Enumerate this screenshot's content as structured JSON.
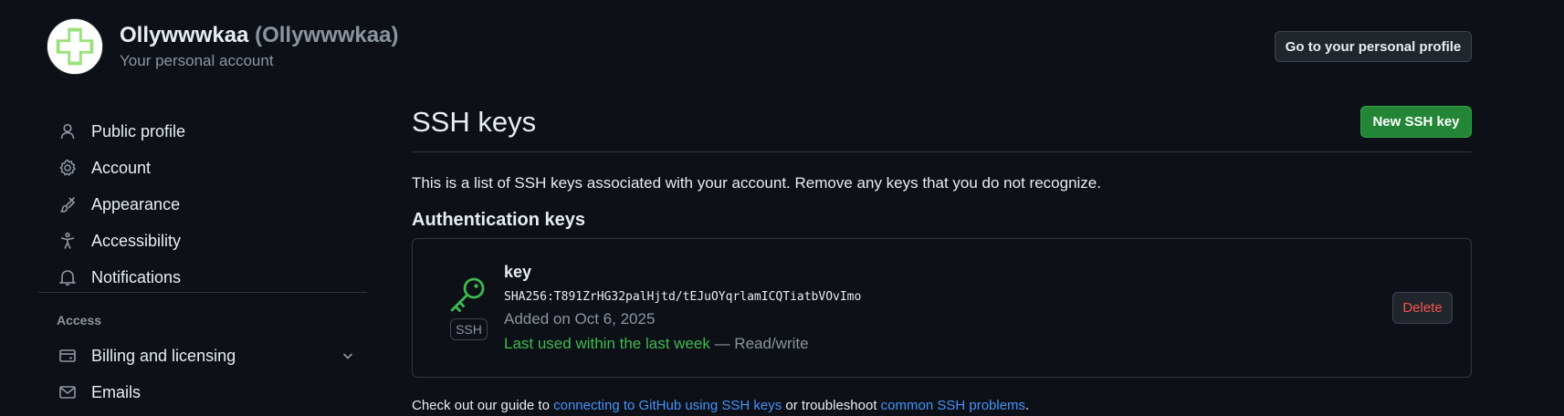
{
  "header": {
    "name": "Ollywwwkaa",
    "login": "(Ollywwwkaa)",
    "subtitle": "Your personal account",
    "profile_button": "Go to your personal profile"
  },
  "sidebar": {
    "items": [
      {
        "label": "Public profile",
        "icon": "person-icon"
      },
      {
        "label": "Account",
        "icon": "gear-icon"
      },
      {
        "label": "Appearance",
        "icon": "paintbrush-icon"
      },
      {
        "label": "Accessibility",
        "icon": "accessibility-icon"
      },
      {
        "label": "Notifications",
        "icon": "bell-icon"
      }
    ],
    "access_heading": "Access",
    "access_items": [
      {
        "label": "Billing and licensing",
        "icon": "credit-card-icon"
      },
      {
        "label": "Emails",
        "icon": "mail-icon"
      }
    ]
  },
  "main": {
    "title": "SSH keys",
    "new_key_button": "New SSH key",
    "intro": "This is a list of SSH keys associated with your account. Remove any keys that you do not recognize.",
    "section_title": "Authentication keys",
    "keys": [
      {
        "title": "key",
        "fingerprint": "SHA256:T891ZrHG32palHjtd/tEJuOYqrlamICQTiatbVOvImo",
        "added": "Added on Oct 6, 2025",
        "last_used": "Last used within the last week",
        "access": " — Read/write",
        "badge": "SSH",
        "delete_label": "Delete",
        "icon": "key-icon"
      }
    ],
    "footer": {
      "prefix": "Check out our guide to ",
      "link1": "connecting to GitHub using SSH keys",
      "middle": " or troubleshoot ",
      "link2": "common SSH problems",
      "suffix": "."
    }
  },
  "colors": {
    "background": "#0d1117",
    "primary_button": "#238636",
    "danger": "#f85149",
    "success": "#3fb950",
    "link": "#4493f8"
  }
}
